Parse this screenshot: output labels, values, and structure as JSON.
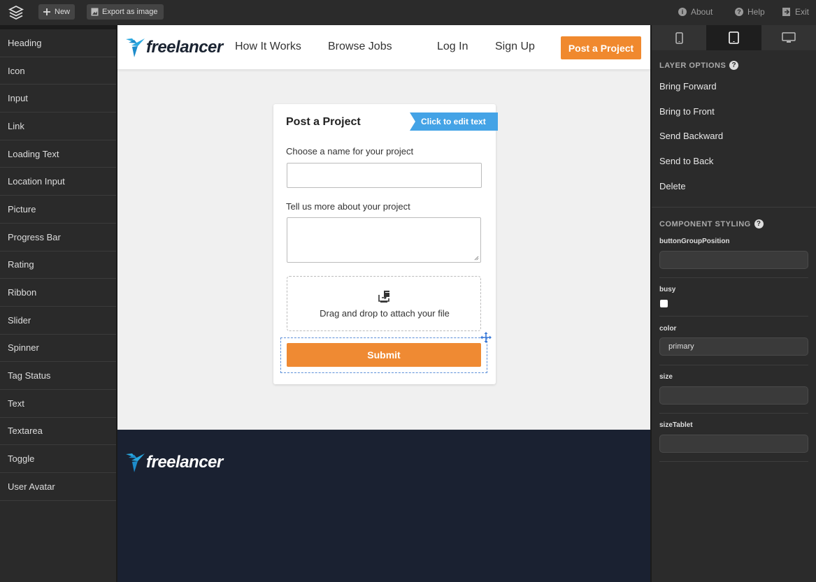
{
  "toolbar": {
    "new_label": "New",
    "export_label": "Export as image",
    "about_label": "About",
    "help_label": "Help",
    "exit_label": "Exit"
  },
  "palette": {
    "items": [
      "Heading",
      "Icon",
      "Input",
      "Link",
      "Loading Text",
      "Location Input",
      "Picture",
      "Progress Bar",
      "Rating",
      "Ribbon",
      "Slider",
      "Spinner",
      "Tag Status",
      "Text",
      "Textarea",
      "Toggle",
      "User Avatar"
    ]
  },
  "site": {
    "brand": "freelancer",
    "nav": {
      "how_it_works": "How It Works",
      "browse_jobs": "Browse Jobs",
      "log_in": "Log In",
      "sign_up": "Sign Up",
      "post_project": "Post a Project"
    },
    "form": {
      "title": "Post a Project",
      "edit_ribbon": "Click to edit text",
      "name_label": "Choose a name for your project",
      "desc_label": "Tell us more about your project",
      "dropzone_text": "Drag and drop to attach your file",
      "submit_label": "Submit"
    },
    "colors": {
      "accent": "#f0892e",
      "brand_blue": "#44a3e6",
      "footer_bg": "#1a2131"
    }
  },
  "right_panel": {
    "layer_options_title": "LAYER OPTIONS",
    "layer_items": [
      "Bring Forward",
      "Bring to Front",
      "Send Backward",
      "Send to Back",
      "Delete"
    ],
    "styling_title": "COMPONENT STYLING",
    "props": {
      "buttonGroupPosition": {
        "label": "buttonGroupPosition",
        "value": ""
      },
      "busy": {
        "label": "busy",
        "checked": false
      },
      "color": {
        "label": "color",
        "value": "primary"
      },
      "size": {
        "label": "size",
        "value": ""
      },
      "sizeTablet": {
        "label": "sizeTablet",
        "value": ""
      }
    }
  }
}
